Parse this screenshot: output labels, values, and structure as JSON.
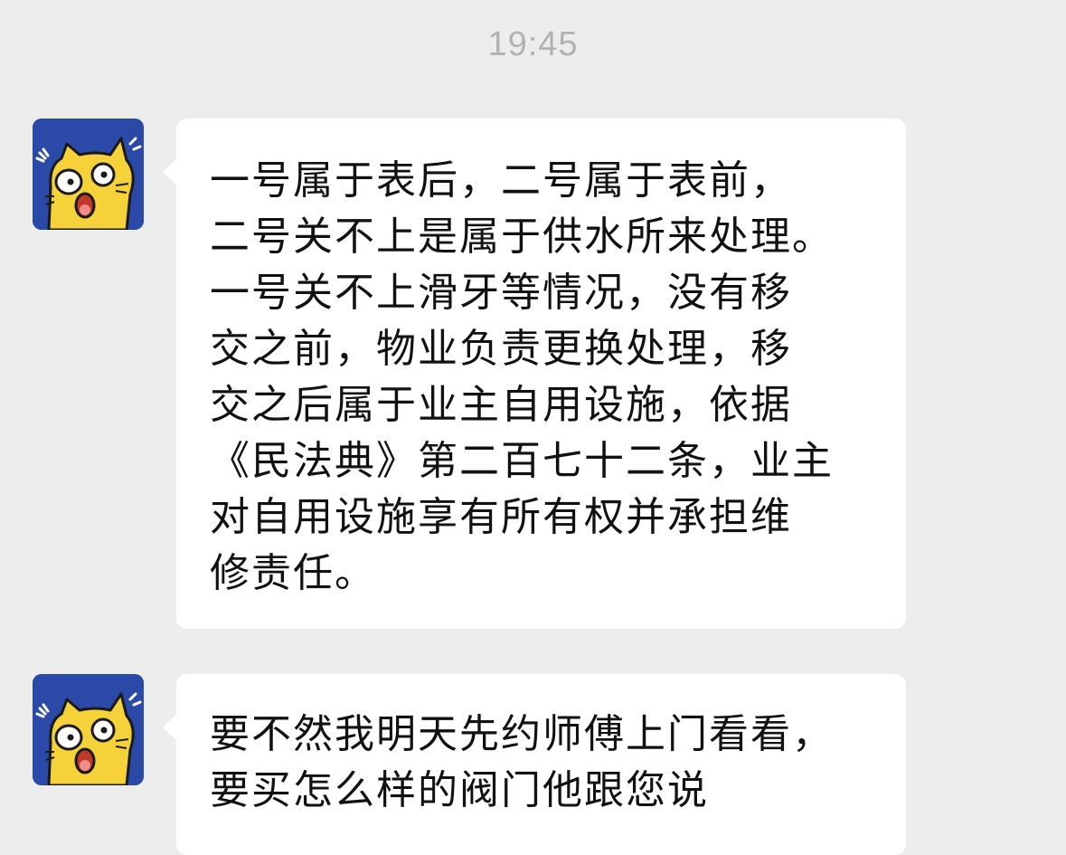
{
  "chat": {
    "timestamp": "19:45",
    "messages": [
      {
        "sender_avatar_icon": "yellow-cat-shocked-avatar",
        "text": "一号属于表后，二号属于表前，\n二号关不上是属于供水所来处理。\n一号关不上滑牙等情况，没有移\n交之前，物业负责更换处理，移\n交之后属于业主自用设施，依据\n《民法典》第二百七十二条，业主\n对自用设施享有所有权并承担维\n修责任。"
      },
      {
        "sender_avatar_icon": "yellow-cat-shocked-avatar",
        "text": "要不然我明天先约师傅上门看看，\n要买怎么样的阀门他跟您说"
      }
    ]
  },
  "colors": {
    "background": "#ededed",
    "bubble": "#ffffff",
    "avatar_bg": "#2b4aa8",
    "cat_yellow": "#f6d23a",
    "timestamp_text": "#b2b2b2"
  }
}
